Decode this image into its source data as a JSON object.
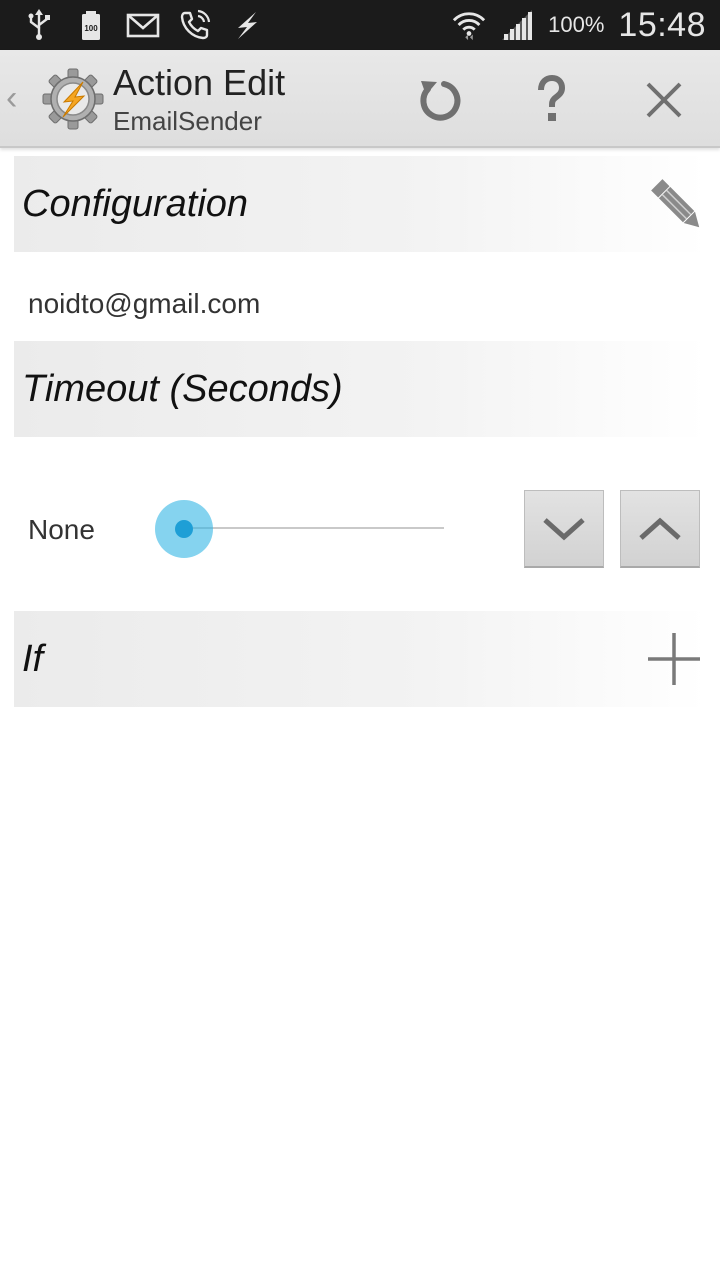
{
  "status_bar": {
    "icons": [
      "usb-icon",
      "battery-full-icon",
      "gmail-icon",
      "missed-call-icon",
      "tasker-bolt-icon",
      "wifi-icon",
      "signal-icon"
    ],
    "battery_percent": "100%",
    "time": "15:48"
  },
  "action_bar": {
    "back_glyph": "‹",
    "title": "Action Edit",
    "subtitle": "EmailSender",
    "buttons": [
      "revert-icon",
      "help-icon",
      "close-icon"
    ]
  },
  "sections": {
    "configuration": {
      "title": "Configuration",
      "value": "noidto@gmail.com"
    },
    "timeout": {
      "title": "Timeout (Seconds)",
      "value_label": "None",
      "slider_level": 0
    },
    "if": {
      "title": "If"
    }
  },
  "colors": {
    "accent": "#33b5e5",
    "statusbar": "#1b1b1b",
    "actionbar": "#e4e4e4"
  }
}
